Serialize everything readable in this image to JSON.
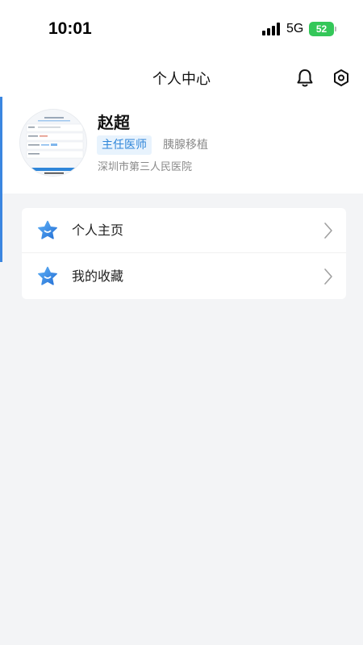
{
  "status_bar": {
    "time": "10:01",
    "network": "5G",
    "battery": "52"
  },
  "nav": {
    "title": "个人中心",
    "icons": [
      "bell-icon",
      "settings-icon"
    ]
  },
  "profile": {
    "name": "赵超",
    "title_tag": "主任医师",
    "department": "胰腺移植",
    "hospital": "深圳市第三人民医院"
  },
  "menu": {
    "items": [
      {
        "label": "个人主页",
        "icon": "star-icon"
      },
      {
        "label": "我的收藏",
        "icon": "star-icon"
      }
    ]
  },
  "colors": {
    "accent": "#2f86d9",
    "tag_bg": "#e8f3fd",
    "background": "#f3f4f6",
    "battery": "#34c759"
  }
}
